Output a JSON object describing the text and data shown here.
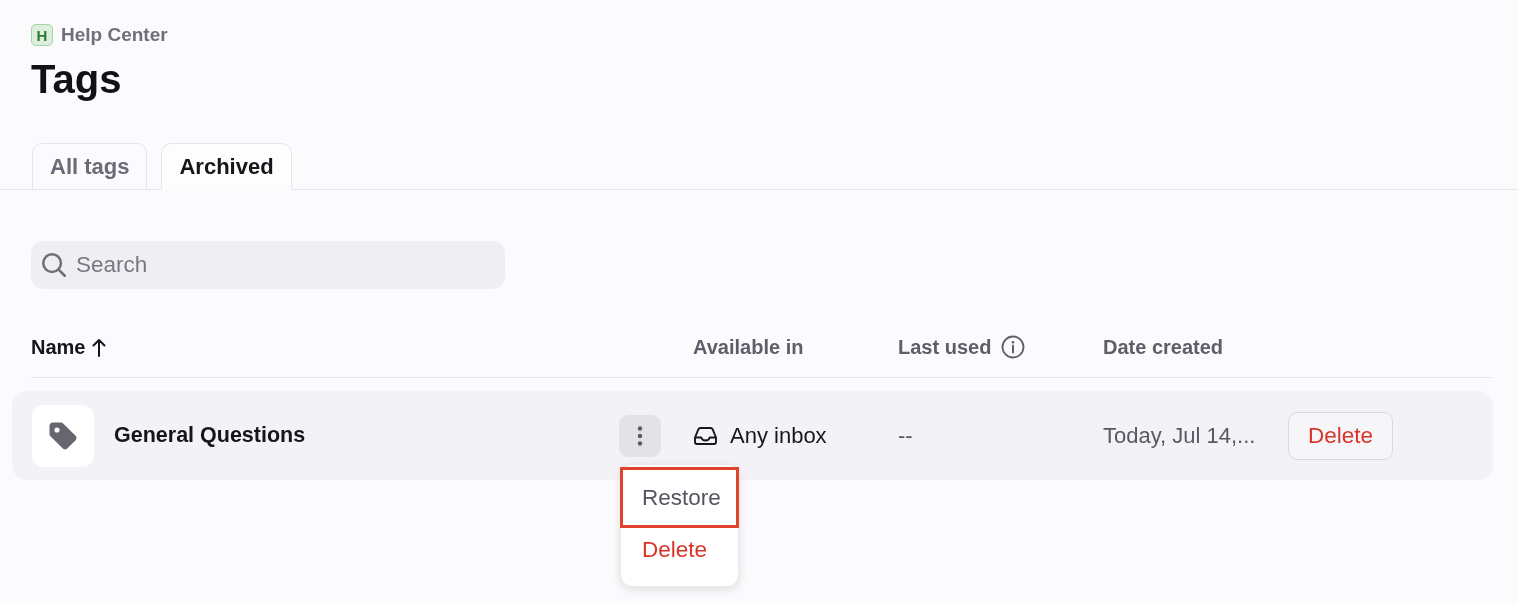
{
  "breadcrumb": {
    "badge": "H",
    "label": "Help Center"
  },
  "title": "Tags",
  "tabs": [
    {
      "label": "All tags",
      "selected": false
    },
    {
      "label": "Archived",
      "selected": true
    }
  ],
  "search": {
    "placeholder": "Search"
  },
  "table": {
    "columns": [
      {
        "label": "Name",
        "sorted": true,
        "info": false
      },
      {
        "label": "Available in",
        "sorted": false,
        "info": false
      },
      {
        "label": "Last used",
        "sorted": false,
        "info": true
      },
      {
        "label": "Date created",
        "sorted": false,
        "info": false
      }
    ],
    "rows": [
      {
        "name": "General Questions",
        "menu_open": true,
        "available_in": "Any inbox",
        "last_used": "--",
        "date_created": "Today, Jul 14,...",
        "action": "Delete",
        "menu": [
          {
            "label": "Restore",
            "kind": "default",
            "highlighted": true
          },
          {
            "label": "Delete",
            "kind": "danger",
            "highlighted": false
          }
        ]
      }
    ]
  }
}
